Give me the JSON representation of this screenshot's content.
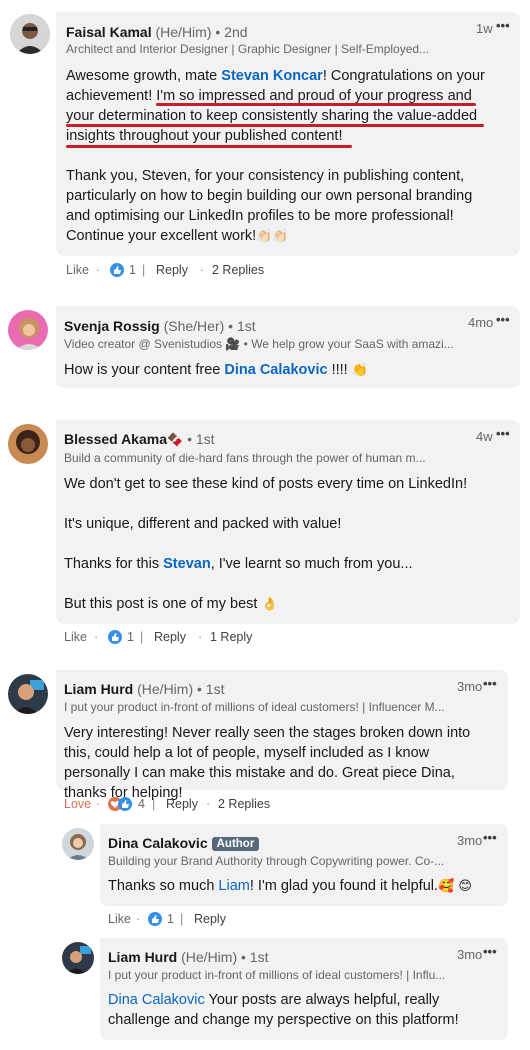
{
  "comments": [
    {
      "name": "Faisal Kamal",
      "pronouns": "(He/Him)",
      "degree": "• 2nd",
      "headline": "Architect and Interior Designer | Graphic Designer | Self-Employed...",
      "time": "1w",
      "more": "•••",
      "body": {
        "p1_a": "Awesome growth, mate ",
        "p1_mention": "Stevan Koncar",
        "p1_b": "! Congratulations on your achievement! I'm so impressed and proud of your progress and your determination to keep consistently sharing the value-added insights throughout your published content!",
        "p2": "Thank you, Steven, for your consistency in publishing content, particularly on how to begin building our own personal branding and optimising our LinkedIn profiles to be more professional! Continue your excellent work!",
        "p2_emoji": "👏🏻👏🏻"
      },
      "like_label": "Like",
      "reaction_count": "1",
      "reply_label": "Reply",
      "replies": "2 Replies"
    },
    {
      "name": "Svenja Rossig",
      "pronouns": "(She/Her)",
      "degree": "• 1st",
      "headline": "Video creator @ Svenistudios 🎥 • We help grow your SaaS with amazi...",
      "time": "4mo",
      "more": "•••",
      "body_a": "How is your content free ",
      "body_mention": "Dina Calakovic",
      "body_b": " !!!! ",
      "body_emoji": "👏"
    },
    {
      "name": "Blessed Akama",
      "name_emoji": "🍫",
      "degree": "• 1st",
      "headline": "Build a community of die-hard fans through the power of human m...",
      "time": "4w",
      "more": "•••",
      "p1": "We don't get to see these kind of posts every time on LinkedIn!",
      "p2": "It's unique, different and packed with value!",
      "p3_a": "Thanks for this ",
      "p3_mention": "Stevan",
      "p3_b": ", I've learnt so much from you...",
      "p4": "But this post is one of my best ",
      "p4_emoji": "👌",
      "like_label": "Like",
      "reaction_count": "1",
      "reply_label": "Reply",
      "replies": "1 Reply"
    },
    {
      "name": "Liam Hurd",
      "pronouns": "(He/Him)",
      "degree": "• 1st",
      "headline": "I put your product in-front of millions of ideal customers! | Influencer M...",
      "time": "3mo",
      "more": "•••",
      "body": "Very interesting! Never really seen the stages broken down into this, could help a lot of people, myself included as I know personally I can make this mistake and do. Great piece Dina, thanks for helping!",
      "like_label": "Love",
      "reaction_count": "4",
      "reply_label": "Reply",
      "replies": "2 Replies"
    },
    {
      "name": "Dina Calakovic",
      "badge": "Author",
      "headline": "Building your Brand Authority through Copywriting power. Co-...",
      "time": "3mo",
      "more": "•••",
      "body_a": "Thanks so much ",
      "body_mention": "Liam",
      "body_b": "! I'm glad you found it helpful.",
      "body_emoji": "🥰 😊",
      "like_label": "Like",
      "reaction_count": "1",
      "reply_label": "Reply"
    },
    {
      "name": "Liam Hurd",
      "pronouns": "(He/Him)",
      "degree": "• 1st",
      "headline": "I put your product in-front of millions of ideal customers! | Influ...",
      "time": "3mo",
      "more": "•••",
      "body_mention": "Dina Calakovic",
      "body_b": " Your posts are always helpful, really challenge and change my perspective on this platform!"
    }
  ],
  "colors": {
    "bubble": "#f2f2f2",
    "mention": "#0a66c2",
    "underline": "#c81e2b",
    "love": "#e06e56",
    "badge": "#56687a"
  }
}
